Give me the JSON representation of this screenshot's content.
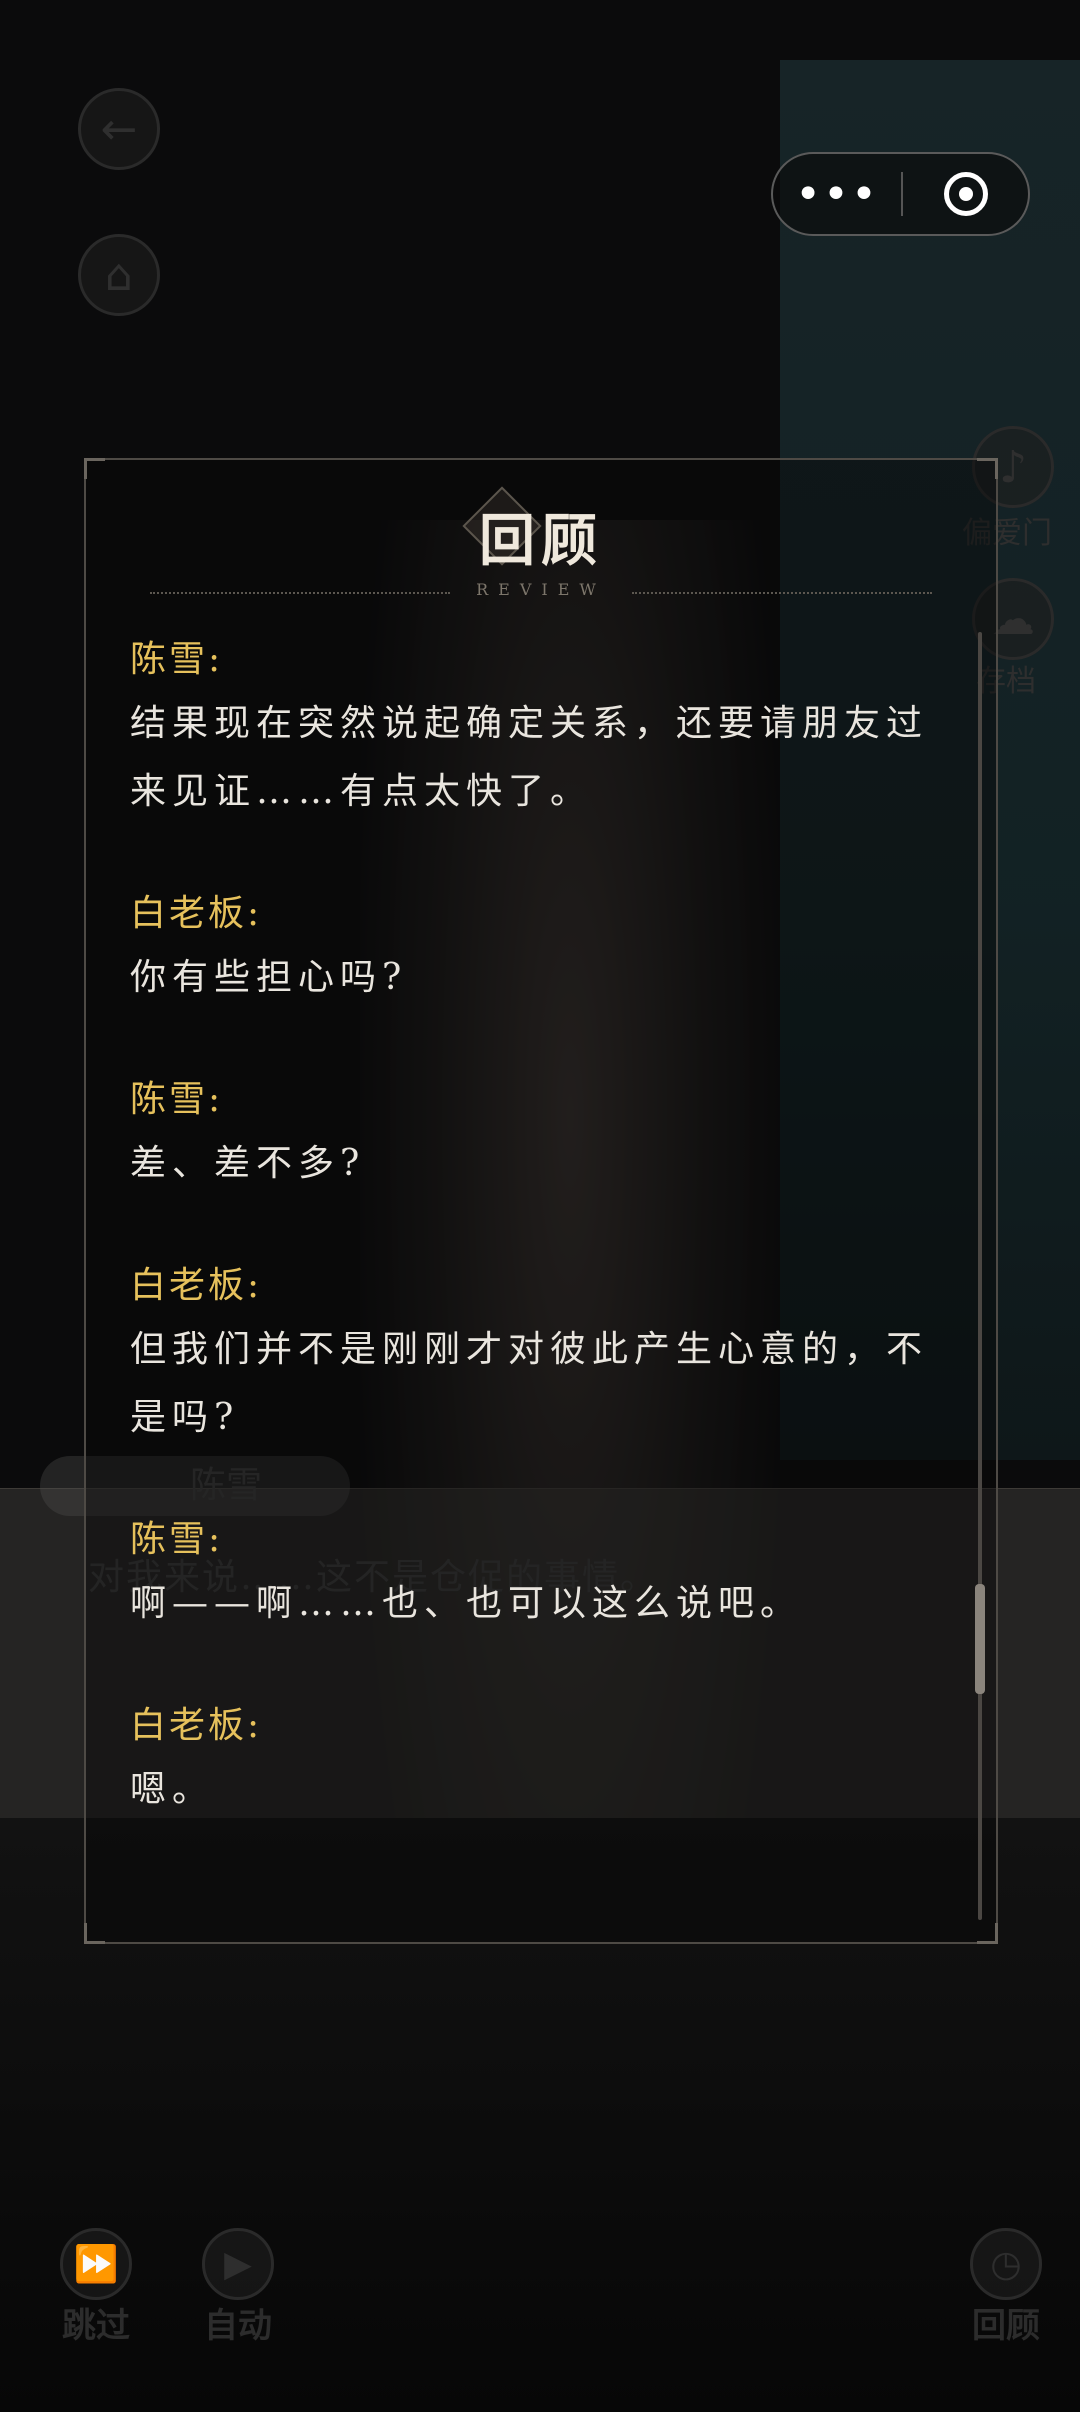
{
  "hud": {
    "top_buttons": [
      {
        "icon": "back-arrow-icon"
      },
      {
        "icon": "home-icon"
      }
    ],
    "side_buttons": [
      {
        "icon": "music-icon",
        "label": "偏爱门"
      },
      {
        "icon": "cloud-icon",
        "label": "存档"
      }
    ],
    "bottom_buttons": [
      {
        "icon": "fast-forward-icon",
        "label": "跳过"
      },
      {
        "icon": "play-icon",
        "label": "自动"
      },
      {
        "icon": "clock-icon",
        "label": "回顾"
      }
    ]
  },
  "capsule": {
    "more_icon": "more-dots-icon",
    "close_icon": "target-close-icon"
  },
  "background_dialog": {
    "speaker": "陈雪",
    "text": "对我来说……这不是仓促的事情。"
  },
  "review": {
    "title": "回顾",
    "subtitle": "REVIEW",
    "entries": [
      {
        "speaker": "陈雪:",
        "text": "结果现在突然说起确定关系，还要请朋友过来见证……有点太快了。"
      },
      {
        "speaker": "白老板:",
        "text": "你有些担心吗?"
      },
      {
        "speaker": "陈雪:",
        "text": "差、差不多?"
      },
      {
        "speaker": "白老板:",
        "text": "但我们并不是刚刚才对彼此产生心意的，不是吗?"
      },
      {
        "speaker": "陈雪:",
        "text": "啊——啊……也、也可以这么说吧。"
      },
      {
        "speaker": "白老板:",
        "text": "嗯。"
      }
    ]
  },
  "colors": {
    "speaker": "#e6c15c",
    "text": "#e9e5de",
    "accent_border": "#4e4a45"
  }
}
